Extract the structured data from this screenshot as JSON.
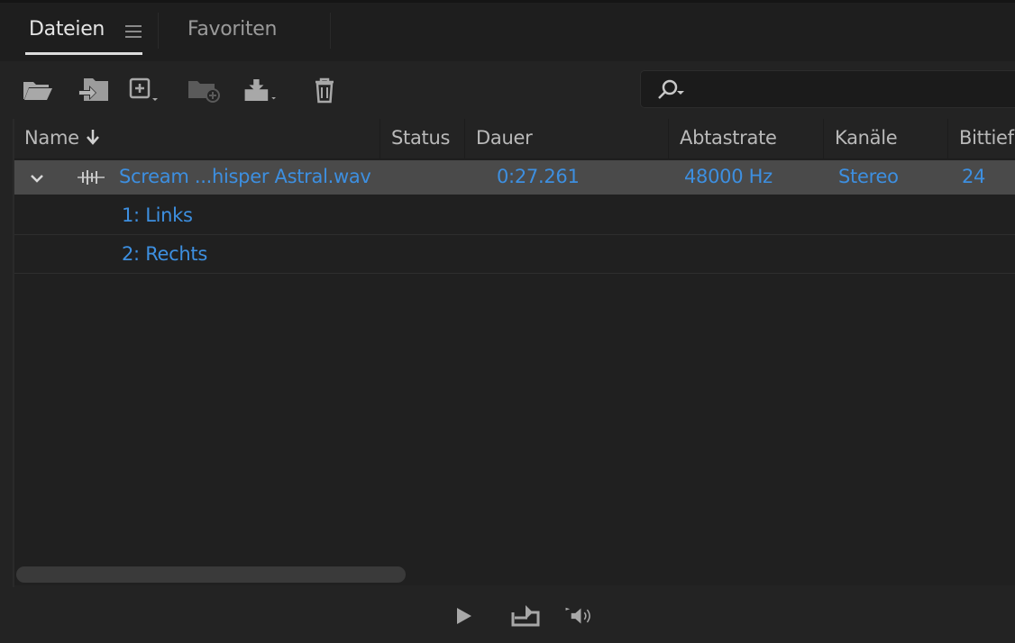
{
  "tabs": [
    {
      "label": "Dateien",
      "active": true
    },
    {
      "label": "Favoriten",
      "active": false
    }
  ],
  "search": {
    "value": "",
    "placeholder": ""
  },
  "columns": [
    "Name",
    "Status",
    "Dauer",
    "Abtastrate",
    "Kanäle",
    "Bittief"
  ],
  "sort_column": "Name",
  "files": [
    {
      "name": "Scream ...hisper Astral.wav",
      "status": "",
      "duration": "0:27.261",
      "sample_rate": "48000 Hz",
      "channels": "Stereo",
      "bit_depth": "24",
      "expanded": true,
      "channel_list": [
        "1: Links",
        "2: Rechts"
      ]
    }
  ],
  "colors": {
    "accent": "#3d8fe0",
    "selected_row": "#4a4a4a",
    "panel": "#232323"
  },
  "toolbar_icons": [
    "open-folder-icon",
    "import-icon",
    "new-file-icon",
    "new-folder-icon",
    "insert-into-multitrack-icon",
    "delete-icon"
  ],
  "transport_icons": [
    "play-icon",
    "loop-icon",
    "auto-play-icon"
  ]
}
